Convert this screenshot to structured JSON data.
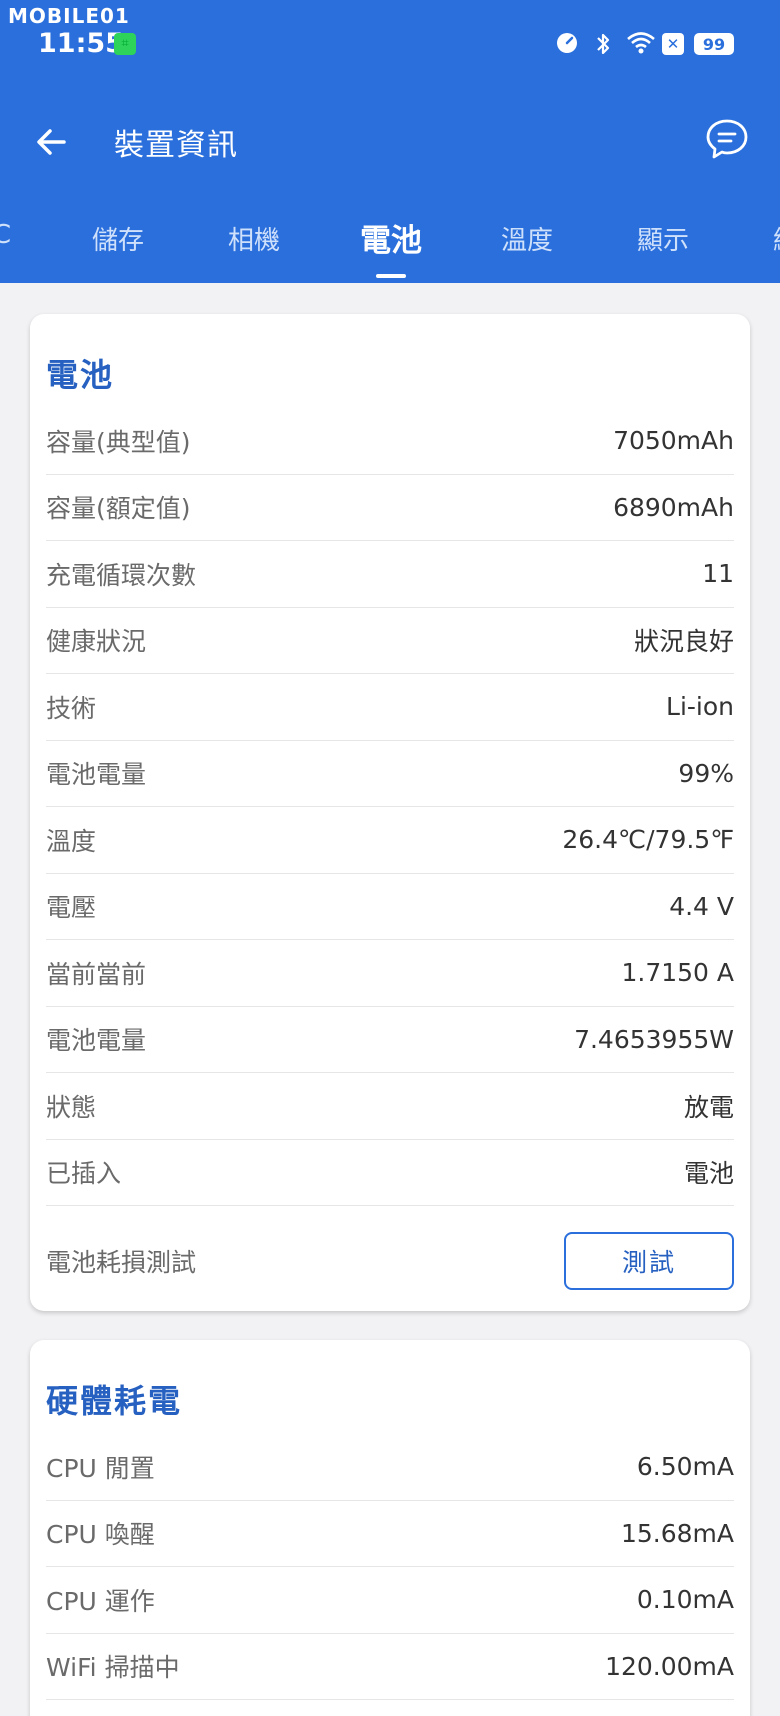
{
  "status_bar": {
    "watermark": "MOBILE01",
    "time": "11:55",
    "battery_level": "99",
    "icons": [
      "speed-icon",
      "bluetooth-icon",
      "wifi-icon",
      "x-notification-icon",
      "battery-icon"
    ]
  },
  "header": {
    "title": "裝置資訊",
    "back_icon": "arrow-left-icon",
    "chat_icon": "chat-bubble-icon",
    "bg_color": "#2a6fdc"
  },
  "tabs": {
    "items": [
      {
        "label": "C"
      },
      {
        "label": "儲存"
      },
      {
        "label": "相機"
      },
      {
        "label": "電池"
      },
      {
        "label": "溫度"
      },
      {
        "label": "顯示"
      },
      {
        "label": "網"
      }
    ],
    "active_index": 3
  },
  "battery_card": {
    "title": "電池",
    "rows": [
      {
        "label": "容量(典型值)",
        "value": "7050mAh"
      },
      {
        "label": "容量(額定值)",
        "value": "6890mAh"
      },
      {
        "label": "充電循環次數",
        "value": "11"
      },
      {
        "label": "健康狀況",
        "value": "狀況良好"
      },
      {
        "label": "技術",
        "value": "Li-ion"
      },
      {
        "label": "電池電量",
        "value": "99%"
      },
      {
        "label": "溫度",
        "value": "26.4℃/79.5℉"
      },
      {
        "label": "電壓",
        "value": "4.4 V"
      },
      {
        "label": "當前當前",
        "value": "1.7150 A"
      },
      {
        "label": "電池電量",
        "value": "7.4653955W"
      },
      {
        "label": "狀態",
        "value": "放電"
      },
      {
        "label": "已插入",
        "value": "電池"
      }
    ],
    "test_label": "電池耗損測試",
    "test_button": "測試"
  },
  "hardware_card": {
    "title": "硬體耗電",
    "rows": [
      {
        "label": "CPU 閒置",
        "value": "6.50mA"
      },
      {
        "label": "CPU 喚醒",
        "value": "15.68mA"
      },
      {
        "label": "CPU 運作",
        "value": "0.10mA"
      },
      {
        "label": "WiFi 掃描中",
        "value": "120.00mA"
      }
    ]
  }
}
